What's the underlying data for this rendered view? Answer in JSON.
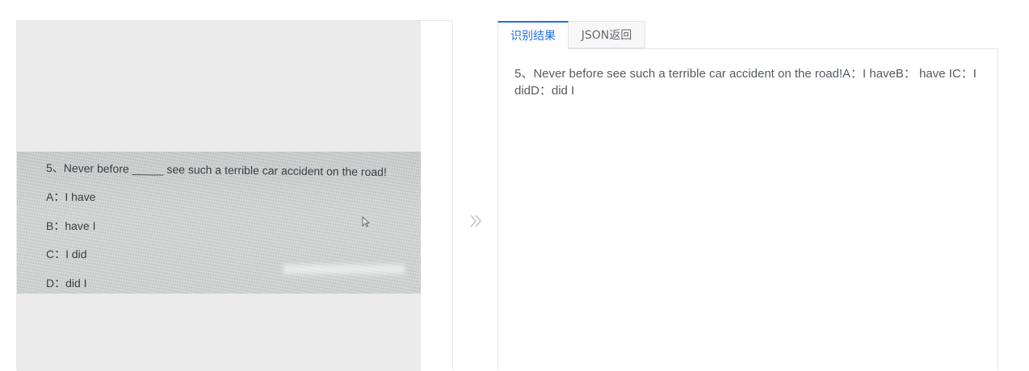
{
  "source_image": {
    "lines": [
      "5、Never before _____ see such a terrible car accident on the road!",
      "A：I have",
      "B：have I",
      "C：I did",
      "D：did I"
    ]
  },
  "tabs": [
    {
      "label": "识别结果",
      "active": true
    },
    {
      "label": "JSON返回",
      "active": false
    }
  ],
  "result": {
    "text": "5、Never before see such a terrible car accident on the road!A：I haveB： have IC：I didD：did I"
  },
  "icons": {
    "arrow": "double-chevron-right-icon",
    "cursor": "mouse-pointer-icon"
  },
  "colors": {
    "accent": "#1f6fe0",
    "panel_bg": "#ebebeb",
    "text": "#555a60"
  }
}
